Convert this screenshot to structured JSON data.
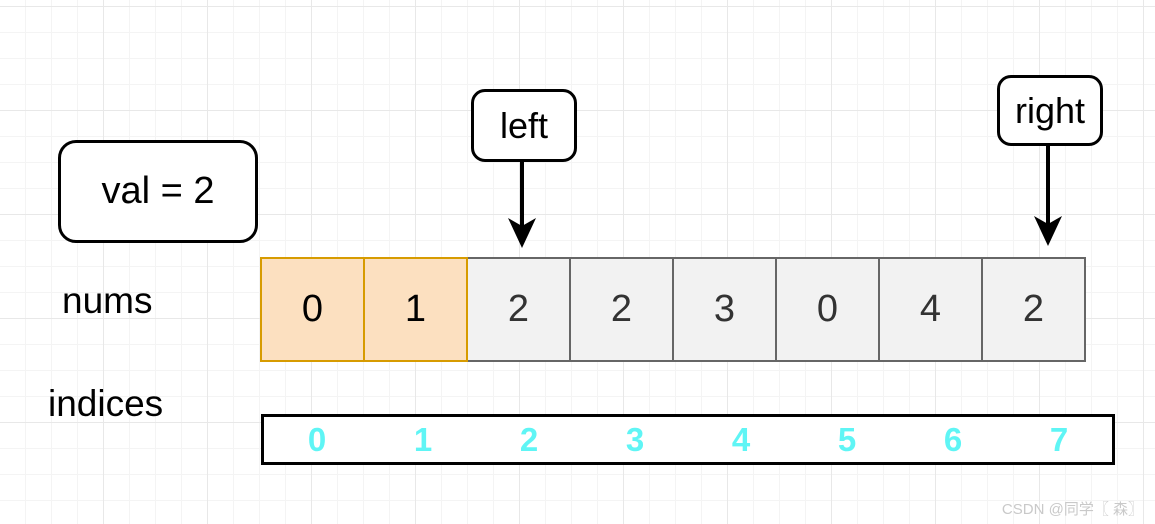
{
  "diagram": {
    "val_box": {
      "label": "val = 2"
    },
    "pointers": [
      {
        "name": "left",
        "label": "left",
        "target_index": 2
      },
      {
        "name": "right",
        "label": "right",
        "target_index": 7
      }
    ],
    "rows": {
      "nums": {
        "label": "nums",
        "cells": [
          {
            "value": "0",
            "state": "highlight"
          },
          {
            "value": "1",
            "state": "highlight"
          },
          {
            "value": "2",
            "state": "plain"
          },
          {
            "value": "2",
            "state": "plain"
          },
          {
            "value": "3",
            "state": "plain"
          },
          {
            "value": "0",
            "state": "plain"
          },
          {
            "value": "4",
            "state": "plain"
          },
          {
            "value": "2",
            "state": "plain"
          }
        ]
      },
      "indices": {
        "label": "indices",
        "values": [
          "0",
          "1",
          "2",
          "3",
          "4",
          "5",
          "6",
          "7"
        ]
      }
    },
    "colors": {
      "highlight_fill": "#fce0c0",
      "highlight_border": "#d79b00",
      "plain_fill": "#f2f2f2",
      "plain_border": "#666666",
      "index_text": "#5ff5f5",
      "outline": "#000000"
    },
    "watermark": "CSDN @同学〖 森〗"
  }
}
